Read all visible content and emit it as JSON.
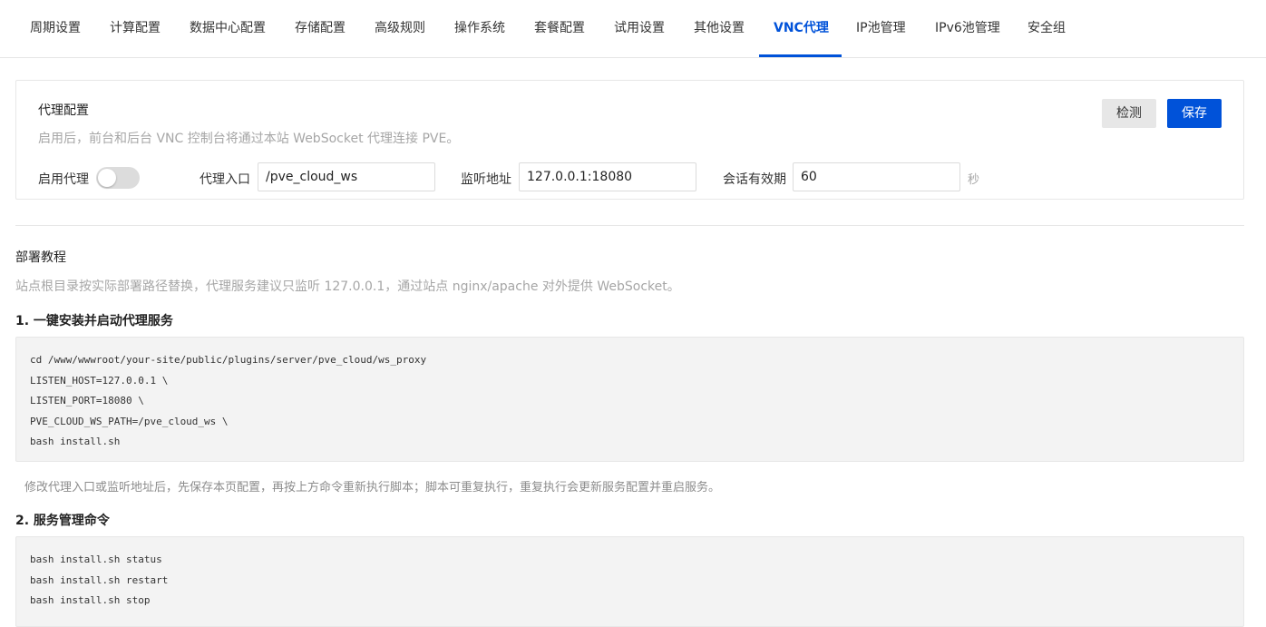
{
  "tabs": [
    {
      "label": "周期设置",
      "active": false
    },
    {
      "label": "计算配置",
      "active": false
    },
    {
      "label": "数据中心配置",
      "active": false
    },
    {
      "label": "存储配置",
      "active": false
    },
    {
      "label": "高级规则",
      "active": false
    },
    {
      "label": "操作系统",
      "active": false
    },
    {
      "label": "套餐配置",
      "active": false
    },
    {
      "label": "试用设置",
      "active": false
    },
    {
      "label": "其他设置",
      "active": false
    },
    {
      "label": "VNC代理",
      "active": true
    },
    {
      "label": "IP池管理",
      "active": false
    },
    {
      "label": "IPv6池管理",
      "active": false
    },
    {
      "label": "安全组",
      "active": false
    }
  ],
  "proxy_config": {
    "title": "代理配置",
    "description": "启用后，前台和后台 VNC 控制台将通过本站 WebSocket 代理连接 PVE。",
    "detect_label": "检测",
    "save_label": "保存",
    "enable_label": "启用代理",
    "enabled": false,
    "entry_label": "代理入口",
    "entry_value": "/pve_cloud_ws",
    "listen_label": "监听地址",
    "listen_value": "127.0.0.1:18080",
    "session_label": "会话有效期",
    "session_value": "60",
    "session_unit": "秒"
  },
  "tutorial": {
    "title": "部署教程",
    "description": "站点根目录按实际部署路径替换，代理服务建议只监听 127.0.0.1，通过站点 nginx/apache 对外提供 WebSocket。",
    "step1_title": "1. 一键安装并启动代理服务",
    "step1_code": [
      "cd /www/wwwroot/your-site/public/plugins/server/pve_cloud/ws_proxy",
      "LISTEN_HOST=127.0.0.1 \\",
      "LISTEN_PORT=18080 \\",
      "PVE_CLOUD_WS_PATH=/pve_cloud_ws \\",
      "bash install.sh"
    ],
    "step1_note": "修改代理入口或监听地址后，先保存本页配置，再按上方命令重新执行脚本；脚本可重复执行，重复执行会更新服务配置并重启服务。",
    "step2_title": "2. 服务管理命令",
    "step2_code": [
      "bash install.sh status",
      "bash install.sh restart",
      "bash install.sh stop"
    ]
  },
  "colors": {
    "accent": "#0052d9",
    "muted_text": "#a6a6a6",
    "code_bg": "#f3f3f3",
    "border": "#e7e7e7"
  }
}
